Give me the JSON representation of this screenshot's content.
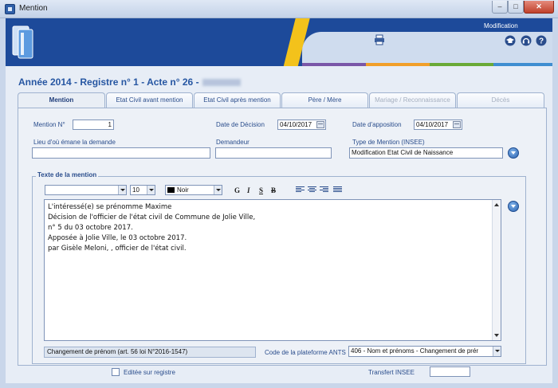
{
  "window": {
    "title": "Mention",
    "minimize_label": "–",
    "maximize_label": "□",
    "close_label": "✕"
  },
  "header": {
    "mode_label": "Modification",
    "icons": [
      "printer-icon",
      "graduation-cap-icon",
      "headset-icon",
      "help-icon"
    ]
  },
  "page": {
    "title": "Année 2014 - Registre n° 1 - Acte n° 26 -"
  },
  "tabs": [
    {
      "label": "Mention",
      "state": "active"
    },
    {
      "label": "Etat Civil avant mention",
      "state": "normal"
    },
    {
      "label": "Etat Civil après mention",
      "state": "normal"
    },
    {
      "label": "Père / Mère",
      "state": "normal"
    },
    {
      "label": "Mariage / Reconnaissance",
      "state": "disabled"
    },
    {
      "label": "Décès",
      "state": "disabled"
    }
  ],
  "form": {
    "mention_no_label": "Mention N°",
    "mention_no_value": "1",
    "decision_date_label": "Date de Décision",
    "decision_date_value": "04/10/2017",
    "apposition_date_label": "Date d'apposition",
    "apposition_date_value": "04/10/2017",
    "lieu_label": "Lieu d'où émane la demande",
    "lieu_value": "",
    "demandeur_label": "Demandeur",
    "demandeur_value": "",
    "type_label": "Type de Mention (INSEE)",
    "type_value": "Modification Etat Civil de Naissance"
  },
  "text_section": {
    "title": "Texte de la mention",
    "font_value": "",
    "size_value": "10",
    "color_value": "Noir",
    "format_buttons": [
      "G",
      "I",
      "S",
      "B"
    ],
    "lines": [
      "L'intéressé(e) se prénomme Maxime",
      "Décision de l'officier de l'état civil de Commune de Jolie Ville,",
      "n° 5 du 03 octobre 2017.",
      "Apposée à Jolie Ville, le 03 octobre 2017.",
      "par Gisèle Meloni, , officier de l'état civil."
    ]
  },
  "footer": {
    "changement_value": "Changement de prénom (art. 56 loi N°2016-1547)",
    "ants_label": "Code de la plateforme ANTS",
    "ants_value": "406 - Nom et prénoms - Changement de prér",
    "editee_label": "Editée sur registre",
    "transfert_label": "Transfert INSEE",
    "transfert_value": ""
  },
  "colors": {
    "header_blue": "#1d4a9a",
    "accent_yellow": "#f3c21b",
    "title_blue": "#2656a2"
  }
}
